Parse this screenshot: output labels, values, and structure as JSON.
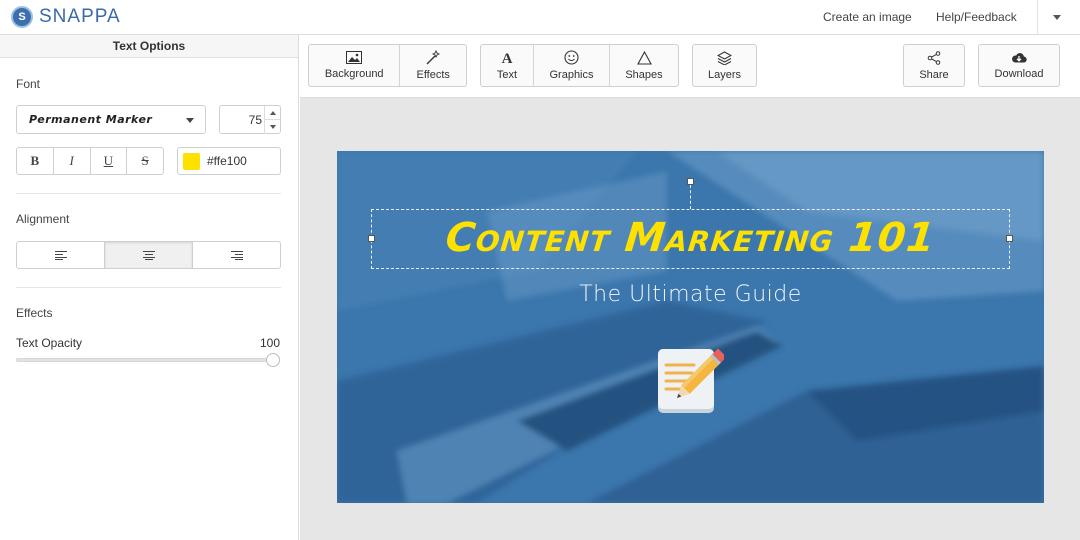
{
  "app": {
    "logo_letter": "S",
    "logo_text": "SNAPPA"
  },
  "topbar": {
    "create_label": "Create an image",
    "help_label": "Help/Feedback"
  },
  "panel": {
    "title": "Text Options",
    "font_section": "Font",
    "font_name": "Permanent Marker",
    "font_size": "75",
    "style_buttons": [
      "B",
      "I",
      "U",
      "S"
    ],
    "color_hex": "#ffe100",
    "color_value": "#ffe100",
    "alignment_section": "Alignment",
    "alignment_selected": "center",
    "effects_section": "Effects",
    "opacity_label": "Text Opacity",
    "opacity_value": "100",
    "opacity_level": 1.0
  },
  "toolbar": {
    "background": "Background",
    "effects": "Effects",
    "text": "Text",
    "graphics": "Graphics",
    "shapes": "Shapes",
    "layers": "Layers",
    "share": "Share",
    "download": "Download"
  },
  "canvas": {
    "headline": "Content Marketing 101",
    "headline_color": "#ffe100",
    "subheadline": "The Ultimate Guide",
    "background_color": "#3b76ac",
    "graphic": "notepad-pencil-icon"
  }
}
